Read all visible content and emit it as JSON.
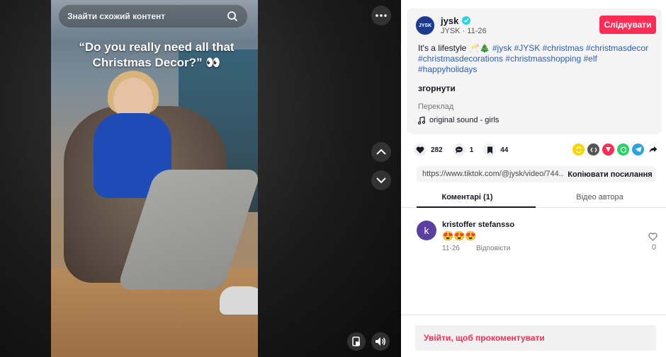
{
  "video": {
    "search_placeholder": "Знайти схожий контент",
    "caption": "“Do you really need all that Christmas Decor?” 👀"
  },
  "author": {
    "name": "jysk",
    "logo_text": "JYSK",
    "subline": "JYSK · 11-26",
    "follow_label": "Слідкувати"
  },
  "description": {
    "text": "It's a lifestyle 🥂🎄",
    "hashtags": [
      "#jysk",
      "#JYSK",
      "#christmas",
      "#christmasdecor",
      "#christmasdecorations",
      "#christmasshopping",
      "#elf",
      "#happyholidays"
    ]
  },
  "collapse_label": "згорнути",
  "translate_label": "Переклад",
  "sound": "original sound - girls",
  "stats": {
    "likes": "282",
    "comments": "1",
    "saves": "44"
  },
  "share": {
    "link": "https://www.tiktok.com/@jysk/video/744...",
    "copy_label": "Копіювати посилання"
  },
  "tabs": [
    "Коментарі (1)",
    "Відео автора"
  ],
  "comment": {
    "avatar_letter": "k",
    "author": "kristoffer stefansso",
    "text": "😍😍😍",
    "date": "11-26",
    "reply_label": "Відповісти",
    "likes": "0"
  },
  "login_prompt": "Увійти, щоб прокоментувати",
  "colors": {
    "accent": "#fe2c55",
    "hashtag": "#2b5db9",
    "verified": "#20d5ec"
  }
}
